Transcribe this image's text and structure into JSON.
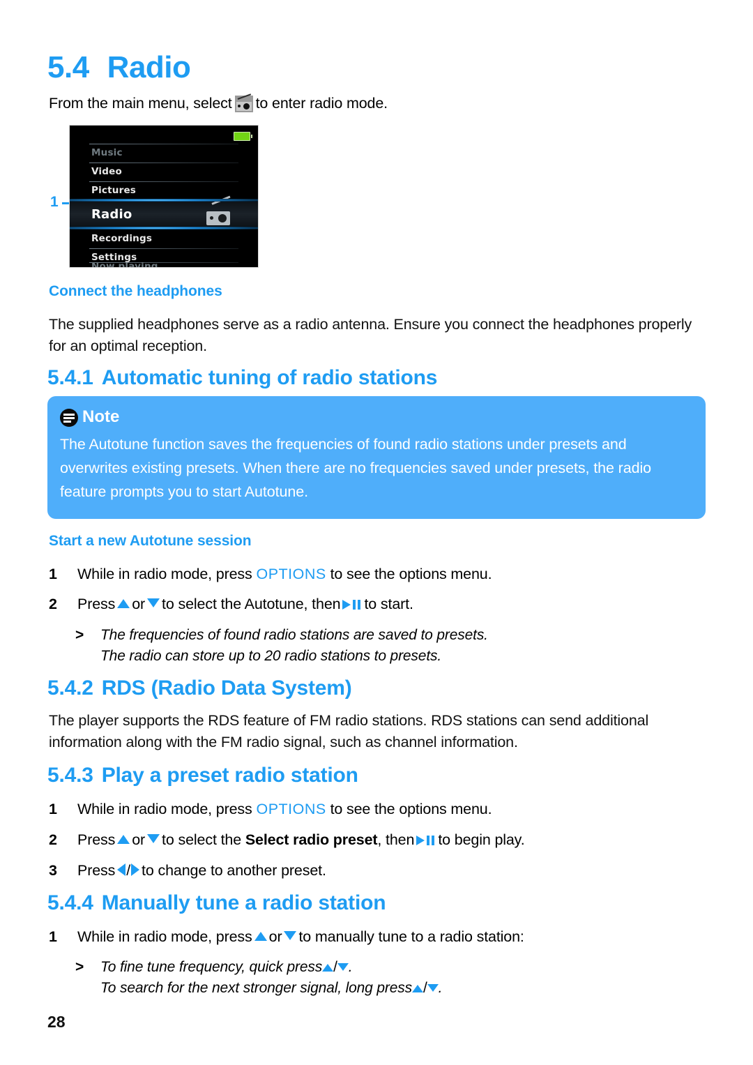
{
  "page": {
    "number": "28",
    "accent_color": "#1E9CF2",
    "note_box_color": "#4FAEFA"
  },
  "section": {
    "number": "5.4",
    "title": "Radio",
    "intro_before_icon": "From the main menu, select",
    "intro_after_icon": "to enter radio mode."
  },
  "device_screenshot": {
    "callout_label": "1",
    "menu_items": [
      {
        "label": "Music",
        "state": "dim"
      },
      {
        "label": "Video",
        "state": "normal"
      },
      {
        "label": "Pictures",
        "state": "normal"
      },
      {
        "label": "Radio",
        "state": "selected"
      },
      {
        "label": "Recordings",
        "state": "normal"
      },
      {
        "label": "Settings",
        "state": "normal"
      },
      {
        "label": "Now playing",
        "state": "dim"
      }
    ],
    "battery_icon": "battery-full-icon",
    "selected_item_icon": "radio-icon"
  },
  "headphones": {
    "heading": "Connect the headphones",
    "body": "The supplied headphones serve as a radio antenna. Ensure you connect the headphones properly for an optimal reception."
  },
  "autotune": {
    "number": "5.4.1",
    "title": "Automatic tuning of radio stations",
    "note": {
      "label": "Note",
      "icon": "note-icon",
      "paragraph_1": "The Autotune function saves the frequencies of found radio stations under presets and overwrites existing presets.",
      "paragraph_2": "When there are no frequencies saved under presets, the radio feature prompts you to start Autotune."
    },
    "subheading": "Start a new Autotune session",
    "step_1": {
      "num": "1",
      "a": "While in radio mode, press",
      "keyword": "OPTIONS",
      "b": "to see the options menu."
    },
    "step_2": {
      "num": "2",
      "a": "Press",
      "or": "or",
      "b": "to select the Autotune, then",
      "c": "to start."
    },
    "result_1": "The frequencies of found radio stations are saved to presets.",
    "result_2": "The radio can store up to 20 radio stations to presets.",
    "result_marker": ">"
  },
  "rds": {
    "number": "5.4.2",
    "title": "RDS (Radio Data System)",
    "body": "The player supports the RDS feature of FM radio stations. RDS stations can send additional information along with the FM radio signal, such as channel information."
  },
  "preset": {
    "number": "5.4.3",
    "title": "Play a preset radio station",
    "step_1": {
      "num": "1",
      "a": "While in radio mode, press",
      "keyword": "OPTIONS",
      "b": "to see the options menu."
    },
    "step_2": {
      "num": "2",
      "a": "Press",
      "or": "or",
      "b": "to select the",
      "bold": "Select radio preset",
      "c": ", then",
      "d": "to begin play."
    },
    "step_3": {
      "num": "3",
      "a": "Press",
      "b": "to change to another preset."
    }
  },
  "manual": {
    "number": "5.4.4",
    "title": "Manually tune a radio station",
    "step_1": {
      "num": "1",
      "a": "While in radio mode, press",
      "or": "or",
      "b": "to manually tune to a radio station:"
    },
    "result_marker": ">",
    "result_1_a": "To fine tune frequency, quick press",
    "result_1_b": ".",
    "result_2_a": "To search for the next stronger signal, long press",
    "result_2_b": "."
  }
}
